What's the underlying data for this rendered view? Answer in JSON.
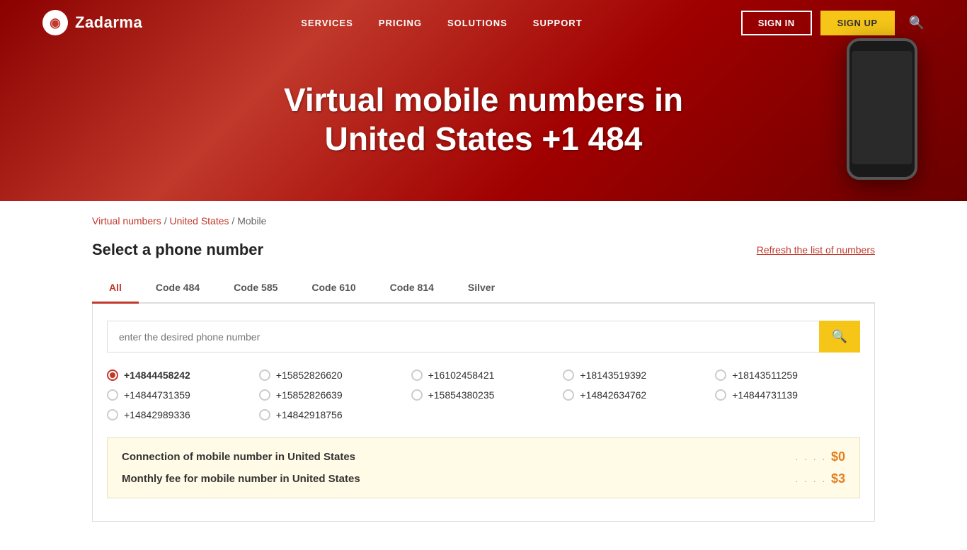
{
  "brand": {
    "name": "Zadarma",
    "logo_symbol": "◉"
  },
  "nav": {
    "links": [
      {
        "label": "SERVICES",
        "href": "#"
      },
      {
        "label": "PRICING",
        "href": "#"
      },
      {
        "label": "SOLUTIONS",
        "href": "#"
      },
      {
        "label": "SUPPORT",
        "href": "#"
      }
    ],
    "signin_label": "SIGN IN",
    "signup_label": "SIGN UP"
  },
  "hero": {
    "title": "Virtual mobile numbers in United States +1 484"
  },
  "breadcrumb": {
    "items": [
      {
        "label": "Virtual numbers",
        "href": "#"
      },
      {
        "label": "United States",
        "href": "#"
      },
      {
        "label": "Mobile",
        "href": null
      }
    ]
  },
  "section": {
    "title": "Select a phone number",
    "refresh_label": "Refresh the list of numbers"
  },
  "tabs": [
    {
      "label": "All",
      "active": true
    },
    {
      "label": "Code 484"
    },
    {
      "label": "Code 585"
    },
    {
      "label": "Code 610"
    },
    {
      "label": "Code 814"
    },
    {
      "label": "Silver"
    }
  ],
  "search": {
    "placeholder": "enter the desired phone number"
  },
  "numbers": [
    {
      "number": "+14844458242",
      "selected": true
    },
    {
      "number": "+15852826620",
      "selected": false
    },
    {
      "number": "+16102458421",
      "selected": false
    },
    {
      "number": "+18143519392",
      "selected": false
    },
    {
      "number": "+18143511259",
      "selected": false
    },
    {
      "number": "+14844731359",
      "selected": false
    },
    {
      "number": "+15852826639",
      "selected": false
    },
    {
      "number": "+15854380235",
      "selected": false
    },
    {
      "number": "+14842634762",
      "selected": false
    },
    {
      "number": "+14844731139",
      "selected": false
    },
    {
      "number": "+14842989336",
      "selected": false
    },
    {
      "number": "+14842918756",
      "selected": false
    }
  ],
  "pricing": [
    {
      "label": "Connection of mobile number in United States",
      "price": "$0"
    },
    {
      "label": "Monthly fee for mobile number in United States",
      "price": "$3"
    }
  ]
}
